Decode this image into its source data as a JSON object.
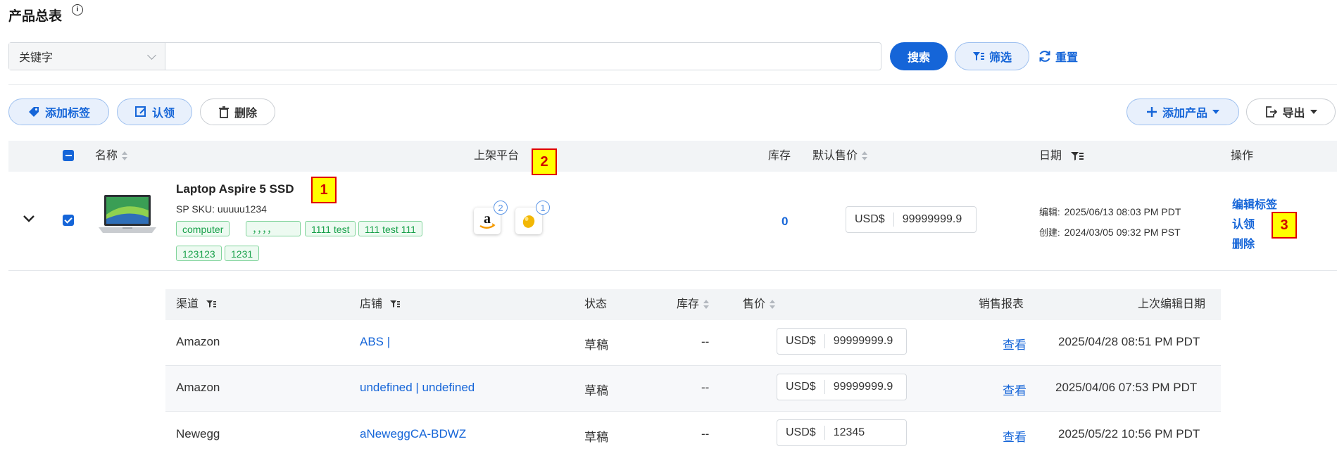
{
  "page": {
    "title": "产品总表"
  },
  "search": {
    "field_select": "关键字",
    "placeholder": "",
    "search_btn": "搜索",
    "filter_btn": "筛选",
    "reset_btn": "重置"
  },
  "toolbar": {
    "add_tag": "添加标签",
    "claim": "认领",
    "delete": "删除",
    "add_product": "添加产品",
    "export": "导出"
  },
  "table": {
    "headers": {
      "name": "名称",
      "platform": "上架平台",
      "stock": "库存",
      "price": "默认售价",
      "date": "日期",
      "action": "操作"
    }
  },
  "product": {
    "name": "Laptop Aspire 5 SSD",
    "sku": "SP SKU: uuuuu1234",
    "tags": [
      "computer",
      "，，，，",
      "1111 test",
      "111 test 111",
      "123123",
      "1231"
    ],
    "platforms": [
      {
        "icon": "amazon-icon",
        "count": "2"
      },
      {
        "icon": "egg-icon",
        "count": "1"
      }
    ],
    "stock": "0",
    "currency": "USD$",
    "price": "99999999.9",
    "edited_label": "编辑:",
    "edited": "2025/06/13 08:03 PM PDT",
    "created_label": "创建:",
    "created": "2024/03/05 09:32 PM PST",
    "actions": {
      "edit_tag": "编辑标签",
      "claim": "认领",
      "delete": "删除"
    }
  },
  "annotations": [
    "1",
    "2",
    "3"
  ],
  "channels": {
    "headers": {
      "channel": "渠道",
      "store": "店铺",
      "status": "状态",
      "stock": "库存",
      "price": "售价",
      "report": "销售报表",
      "last_edit": "上次编辑日期"
    },
    "rows": [
      {
        "channel": "Amazon",
        "store": "ABS |",
        "status": "草稿",
        "stock": "--",
        "currency": "USD$",
        "price": "99999999.9",
        "report": "查看",
        "last_edit": "2025/04/28 08:51 PM PDT"
      },
      {
        "channel": "Amazon",
        "store": "undefined | undefined",
        "status": "草稿",
        "stock": "--",
        "currency": "USD$",
        "price": "99999999.9",
        "report": "查看",
        "last_edit": "2025/04/06 07:53 PM PDT"
      },
      {
        "channel": "Newegg",
        "store": "aNeweggCA-BDWZ",
        "status": "草稿",
        "stock": "--",
        "currency": "USD$",
        "price": "12345",
        "report": "查看",
        "last_edit": "2025/05/22 10:56 PM PDT"
      }
    ]
  },
  "colors": {
    "primary": "#1565d8",
    "tag_green": "#18a14a",
    "annotation_red": "#e00000",
    "annotation_yellow": "#ffff00"
  }
}
